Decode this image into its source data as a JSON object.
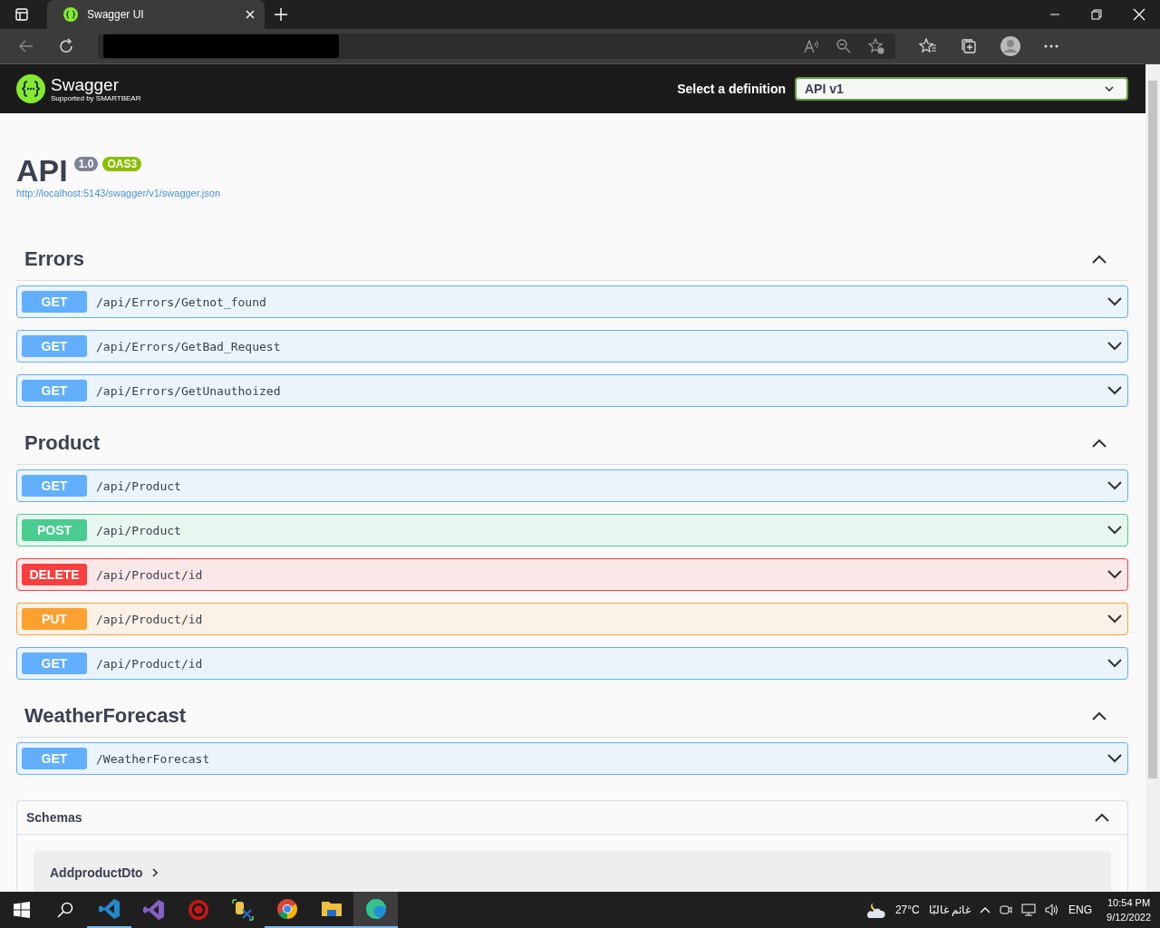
{
  "browser": {
    "tab_title": "Swagger UI"
  },
  "header": {
    "logo_text": "Swagger",
    "logo_subtext": "Supported by SMARTBEAR",
    "definition_label": "Select a definition",
    "definition_value": "API v1"
  },
  "info": {
    "title": "API",
    "version": "1.0",
    "oas": "OAS3",
    "url": "http://localhost:5143/swagger/v1/swagger.json"
  },
  "sections": [
    {
      "name": "Errors",
      "expanded": true,
      "operations": [
        {
          "method": "GET",
          "path": "/api/Errors/Getnot_found",
          "expanded": false
        },
        {
          "method": "GET",
          "path": "/api/Errors/GetBad_Request",
          "expanded": false
        },
        {
          "method": "GET",
          "path": "/api/Errors/GetUnauthoized",
          "expanded": false
        }
      ]
    },
    {
      "name": "Product",
      "expanded": true,
      "operations": [
        {
          "method": "GET",
          "path": "/api/Product",
          "expanded": false
        },
        {
          "method": "POST",
          "path": "/api/Product",
          "expanded": false
        },
        {
          "method": "DELETE",
          "path": "/api/Product/id",
          "expanded": false
        },
        {
          "method": "PUT",
          "path": "/api/Product/id",
          "expanded": false
        },
        {
          "method": "GET",
          "path": "/api/Product/id",
          "expanded": false
        }
      ]
    },
    {
      "name": "WeatherForecast",
      "expanded": true,
      "operations": [
        {
          "method": "GET",
          "path": "/WeatherForecast",
          "expanded": false
        }
      ]
    }
  ],
  "schemas": {
    "title": "Schemas",
    "expanded": true,
    "items": [
      {
        "name": "AddproductDto",
        "expanded": false
      }
    ]
  },
  "taskbar": {
    "weather_temp": "27°C",
    "weather_text": "غائم غالبًا",
    "language": "ENG",
    "time": "10:54 PM",
    "date": "9/12/2022"
  }
}
